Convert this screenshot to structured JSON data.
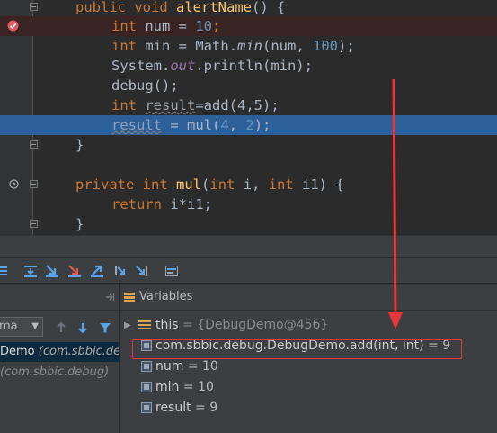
{
  "editor": {
    "lines": [
      {
        "id": "l0",
        "state": "normal"
      },
      {
        "id": "l1",
        "state": "breakpoint"
      },
      {
        "id": "l2",
        "state": "normal"
      },
      {
        "id": "l3",
        "state": "normal"
      },
      {
        "id": "l4",
        "state": "normal"
      },
      {
        "id": "l5",
        "state": "normal"
      },
      {
        "id": "l6",
        "state": "current"
      }
    ],
    "tokens": {
      "public": "public",
      "void": "void",
      "alertName": "alertName",
      "open_sig": "() {",
      "int": "int",
      "num_decl": "num = ",
      "ten": "10",
      "semi": ";",
      "min_decl": "min = Math.",
      "min_call": "min",
      "min_args_open": "(num, ",
      "hundred": "100",
      "close_semi": ");",
      "system": "System.",
      "out": "out",
      "println": ".println(min);",
      "debug_call": "debug();",
      "result_var": "result",
      "eq_add": "=add(4,5);",
      "result_faded": "result",
      "eq_mul": " = mul(",
      "four": "4",
      "comma": ", ",
      "two": "2",
      "brace_close": "}",
      "private": "private",
      "mul": "mul",
      "params_open": "(",
      "param_i": " i, ",
      "param_i1": " i1) {",
      "return": "return",
      "ret_expr": " i*i1;"
    },
    "colors": {
      "keyword": "#cc7832",
      "number": "#6897bb",
      "method": "#ffc66d",
      "static": "#9876aa",
      "text": "#a9b7c6",
      "current_line": "#2d6099",
      "breakpoint_line": "#3a2323"
    }
  },
  "frames_panel": {
    "thread_value": "ma",
    "frames": [
      {
        "method": "Demo",
        "pkg": "(com.sbbic.de",
        "selected": true
      },
      {
        "method": "",
        "pkg": "(com.sbbic.debug)",
        "selected": false
      }
    ]
  },
  "variables_panel": {
    "title": "Variables",
    "items": [
      {
        "name": "this",
        "value": " = {DebugDemo@456}",
        "expandable": true
      },
      {
        "name": "com.sbbic.debug.DebugDemo.add(int, int)",
        "value": " = 9",
        "expandable": false
      },
      {
        "name": "num",
        "value": " = 10",
        "expandable": false
      },
      {
        "name": "min",
        "value": " = 10",
        "expandable": false
      },
      {
        "name": "result",
        "value": " = 9",
        "expandable": false
      }
    ]
  },
  "icons": [
    "breakpoint-icon",
    "override-icon",
    "step-over-icon",
    "step-into-icon",
    "force-step-into-icon",
    "step-out-icon",
    "run-to-cursor-icon",
    "evaluate-icon",
    "up-arrow-icon",
    "down-arrow-icon",
    "filter-icon",
    "variables-icon"
  ],
  "annotation": {
    "color": "#e8343a"
  }
}
